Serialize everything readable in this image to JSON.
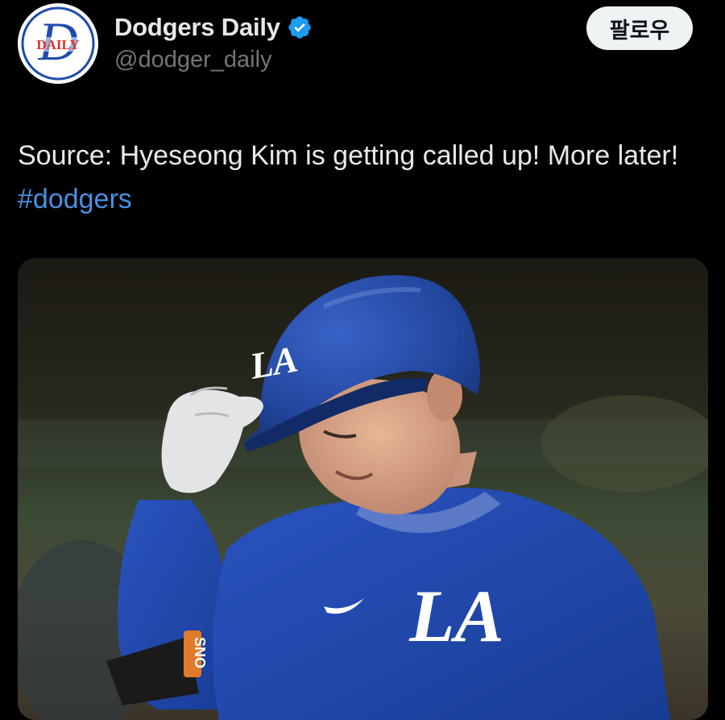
{
  "author": {
    "display_name": "Dodgers Daily",
    "handle": "@dodger_daily",
    "verified": true,
    "avatar_text": "DAILY"
  },
  "follow_button": {
    "label": "팔로우"
  },
  "tweet": {
    "text": "Source: Hyeseong Kim is getting called up! More later! ",
    "hashtag": "#dodgers"
  },
  "media": {
    "helmet_logo": "LA",
    "jersey_logo": "LA",
    "wristband_text": "SNO"
  },
  "colors": {
    "background": "#000000",
    "text_primary": "#e7e9ea",
    "text_secondary": "#71767b",
    "hashtag": "#4a90e2",
    "verified": "#1d9bf0",
    "dodger_blue": "#1f4bb0"
  }
}
